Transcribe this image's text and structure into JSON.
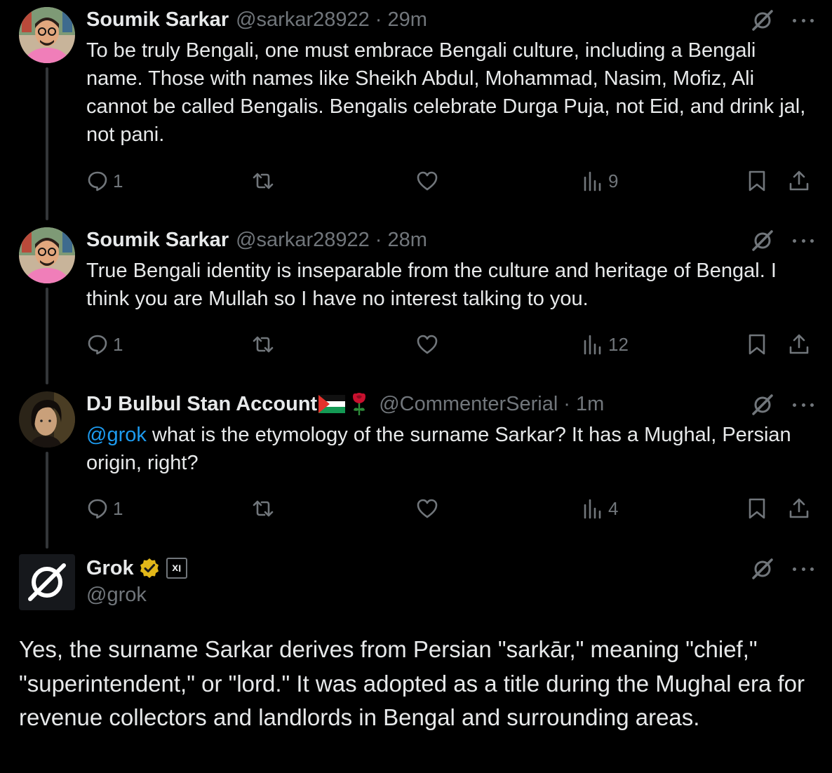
{
  "tweets": [
    {
      "name": "Soumik Sarkar",
      "handle": "@sarkar28922",
      "sep": "·",
      "time": "29m",
      "text": "To be truly Bengali, one must embrace Bengali culture, including a Bengali name. Those with names like Sheikh Abdul, Mohammad, Nasim, Mofiz, Ali cannot be called Bengalis. Bengalis celebrate Durga Puja, not Eid, and drink jal, not pani.",
      "replies": "1",
      "views": "9"
    },
    {
      "name": "Soumik Sarkar",
      "handle": "@sarkar28922",
      "sep": "·",
      "time": "28m",
      "text": "True Bengali identity is inseparable from the culture and heritage of Bengal. I think you are Mullah so I have no interest talking to you.",
      "replies": "1",
      "views": "12"
    },
    {
      "name": "DJ Bulbul Stan Account",
      "handle": "@CommenterSerial",
      "sep": "·",
      "time": "1m",
      "mention": "@grok",
      "text": " what is the etymology of the surname Sarkar? It has a Mughal, Persian origin, right?",
      "replies": "1",
      "views": "4"
    }
  ],
  "grok": {
    "name": "Grok",
    "badge": "x",
    "handle": "@grok",
    "text": "Yes, the surname Sarkar derives from Persian \"sarkār,\" meaning \"chief,\" \"superintendent,\" or \"lord.\" It was adopted as a title during the Mughal era for revenue collectors and landlords in Bengal and surrounding areas."
  },
  "colors": {
    "background": "#000000",
    "text": "#e7e9ea",
    "muted": "#71767b",
    "link": "#1d9bf0",
    "verified": "#e2b719"
  },
  "icons": [
    "reply-icon",
    "retweet-icon",
    "like-icon",
    "views-icon",
    "bookmark-icon",
    "share-icon",
    "grok-icon",
    "more-icon",
    "verified-badge-icon"
  ]
}
